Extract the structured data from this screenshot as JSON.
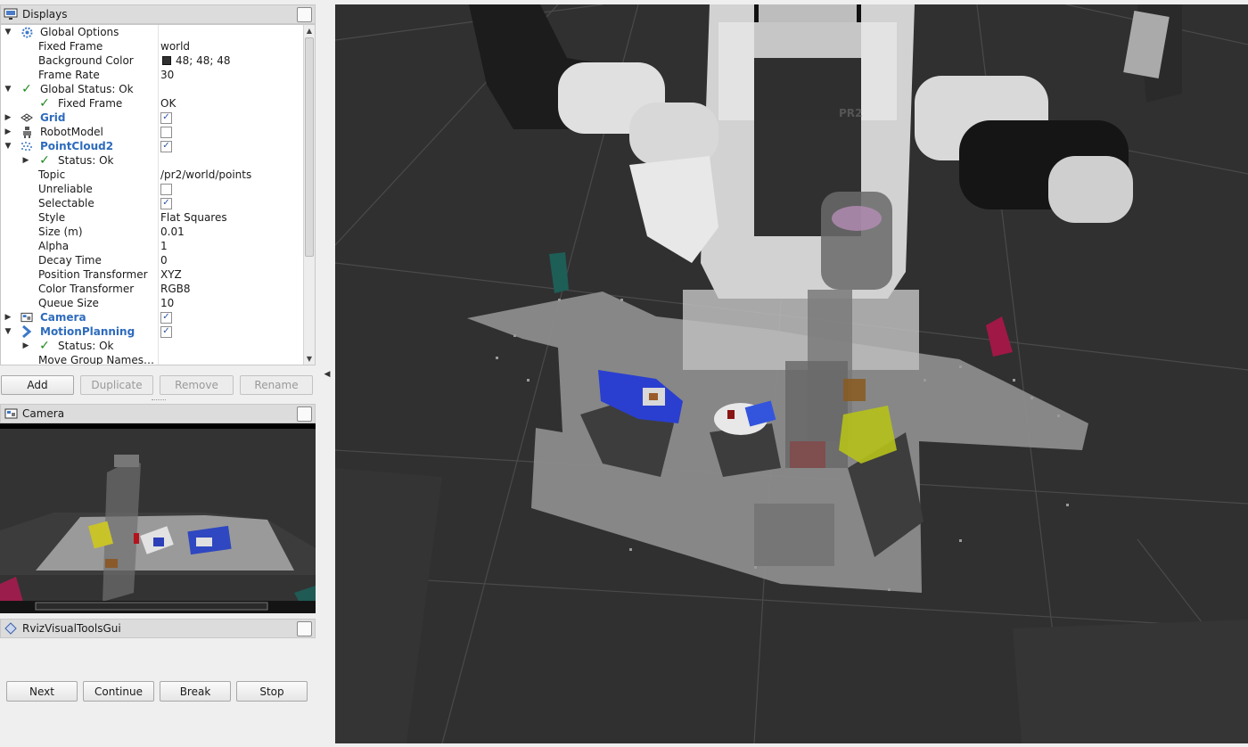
{
  "displays_panel": {
    "title": "Displays",
    "tree": [
      {
        "name": "Global Options",
        "value": ""
      },
      {
        "name": "Fixed Frame",
        "value": "world"
      },
      {
        "name": "Background Color",
        "value": "48; 48; 48"
      },
      {
        "name": "Frame Rate",
        "value": "30"
      },
      {
        "name": "Global Status: Ok",
        "value": ""
      },
      {
        "name": "Fixed Frame",
        "value": "OK"
      },
      {
        "name": "Grid",
        "value": ""
      },
      {
        "name": "RobotModel",
        "value": ""
      },
      {
        "name": "PointCloud2",
        "value": ""
      },
      {
        "name": "Status: Ok",
        "value": ""
      },
      {
        "name": "Topic",
        "value": "/pr2/world/points"
      },
      {
        "name": "Unreliable",
        "value": ""
      },
      {
        "name": "Selectable",
        "value": ""
      },
      {
        "name": "Style",
        "value": "Flat Squares"
      },
      {
        "name": "Size (m)",
        "value": "0.01"
      },
      {
        "name": "Alpha",
        "value": "1"
      },
      {
        "name": "Decay Time",
        "value": "0"
      },
      {
        "name": "Position Transformer",
        "value": "XYZ"
      },
      {
        "name": "Color Transformer",
        "value": "RGB8"
      },
      {
        "name": "Queue Size",
        "value": "10"
      },
      {
        "name": "Camera",
        "value": ""
      },
      {
        "name": "MotionPlanning",
        "value": ""
      },
      {
        "name": "Status: Ok",
        "value": ""
      },
      {
        "name": "Move Group Names…",
        "value": ""
      }
    ],
    "checks": {
      "grid": "✓",
      "robot_model": "",
      "pointcloud2": "✓",
      "unreliable": "",
      "selectable": "✓",
      "camera": "✓",
      "motion_planning": "✓"
    },
    "buttons": {
      "add": "Add",
      "duplicate": "Duplicate",
      "remove": "Remove",
      "rename": "Rename"
    }
  },
  "camera_panel": {
    "title": "Camera"
  },
  "rviz_visual_tools": {
    "title": "RvizVisualToolsGui",
    "buttons": {
      "next": "Next",
      "continue": "Continue",
      "break": "Break",
      "stop": "Stop"
    }
  },
  "viewport": {
    "robot_label": "PR2",
    "background": "#303030"
  },
  "colors": {
    "link_blue": "#2d6bbd",
    "ok_green": "#1e8a1e",
    "grid_line": "#4a4a4a",
    "table_gray": "#8c8c8c"
  }
}
